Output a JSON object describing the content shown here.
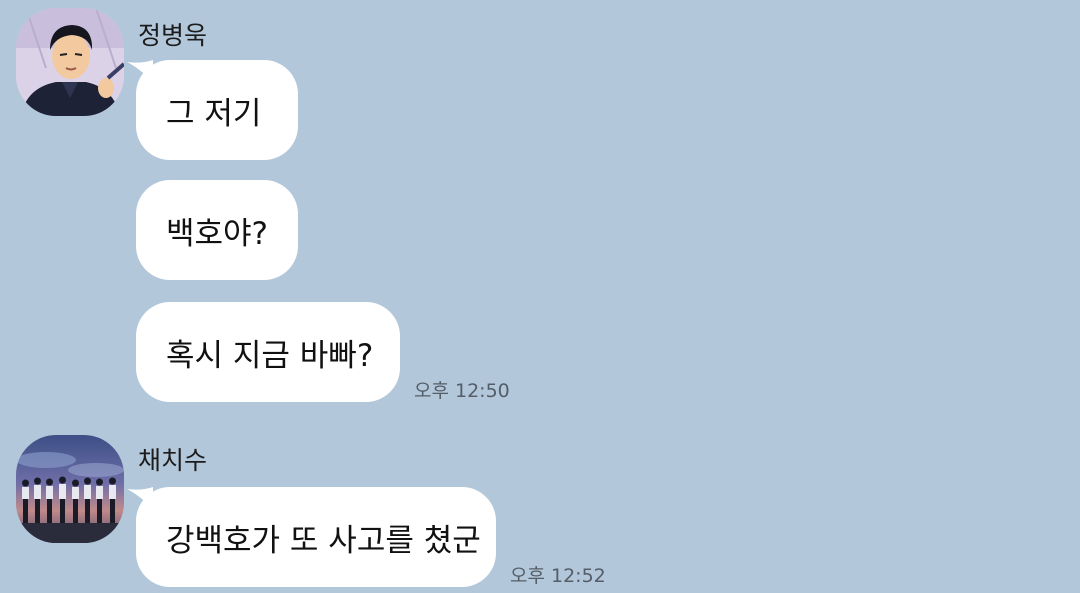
{
  "chat": {
    "groups": [
      {
        "sender": "정병욱",
        "avatar_icon": "anime-student-portrait",
        "messages": [
          "그 저기",
          "백호야?",
          "혹시 지금 바빠?"
        ],
        "time": "오후 12:50"
      },
      {
        "sender": "채치수",
        "avatar_icon": "team-silhouette-sunset",
        "messages": [
          "강백호가 또 사고를 쳤군"
        ],
        "time": "오후 12:52"
      }
    ]
  },
  "colors": {
    "background": "#b2c7da",
    "bubble": "#ffffff",
    "timestamp": "#555e68"
  }
}
